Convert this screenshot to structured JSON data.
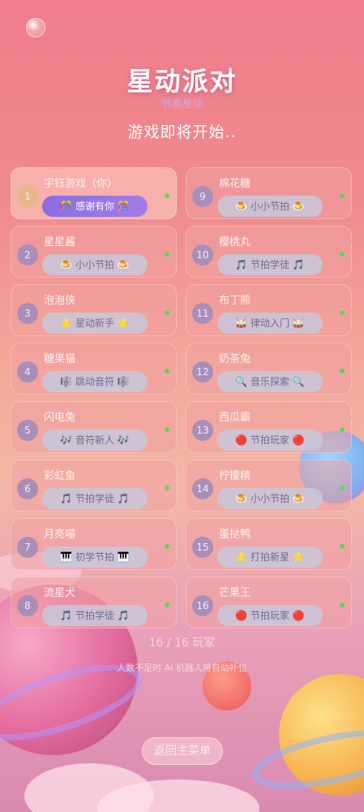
{
  "header": {
    "title": "星动派对",
    "subtitle": "节奏星动",
    "status": "游戏即将开始.."
  },
  "players": [
    {
      "num": "1",
      "name": "宇钰游戏（你）",
      "badge": "🎊 感谢有你 🎊",
      "self": true
    },
    {
      "num": "2",
      "name": "星星酱",
      "badge": "🍮 小小节拍 🍮"
    },
    {
      "num": "3",
      "name": "泡泡侠",
      "badge": "⭐ 星动新手 ⭐"
    },
    {
      "num": "4",
      "name": "糖果猫",
      "badge": "🎼 跳动音符 🎼"
    },
    {
      "num": "5",
      "name": "闪电兔",
      "badge": "🎶 音符新人 🎶"
    },
    {
      "num": "6",
      "name": "彩虹鱼",
      "badge": "🎵 节拍学徒 🎵"
    },
    {
      "num": "7",
      "name": "月亮喵",
      "badge": "🎹 初学节拍 🎹"
    },
    {
      "num": "8",
      "name": "流星犬",
      "badge": "🎵 节拍学徒 🎵"
    },
    {
      "num": "9",
      "name": "棉花糖",
      "badge": "🍮 小小节拍 🍮"
    },
    {
      "num": "10",
      "name": "樱桃丸",
      "badge": "🎵 节拍学徒 🎵"
    },
    {
      "num": "11",
      "name": "布丁熊",
      "badge": "🥁 律动入门 🥁"
    },
    {
      "num": "12",
      "name": "奶茶兔",
      "badge": "🔍 音乐探索 🔍"
    },
    {
      "num": "13",
      "name": "西瓜霸",
      "badge": "🔴 节拍玩家 🔴"
    },
    {
      "num": "14",
      "name": "柠檬精",
      "badge": "🍮 小小节拍 🍮"
    },
    {
      "num": "15",
      "name": "蛋挞鸭",
      "badge": "⭐ 打拍新星 ⭐"
    },
    {
      "num": "16",
      "name": "芒果王",
      "badge": "🔴 节拍玩家 🔴"
    }
  ],
  "footer": {
    "player_count": "16 / 16 玩家",
    "hint": "人数不足时 AI 机器人将自动补位",
    "back_button": "返回主菜单"
  },
  "colors": {
    "online_dot": "#5fd35f",
    "self_badge": "#8a6de0",
    "badge_gray": "#c8c8dc"
  }
}
